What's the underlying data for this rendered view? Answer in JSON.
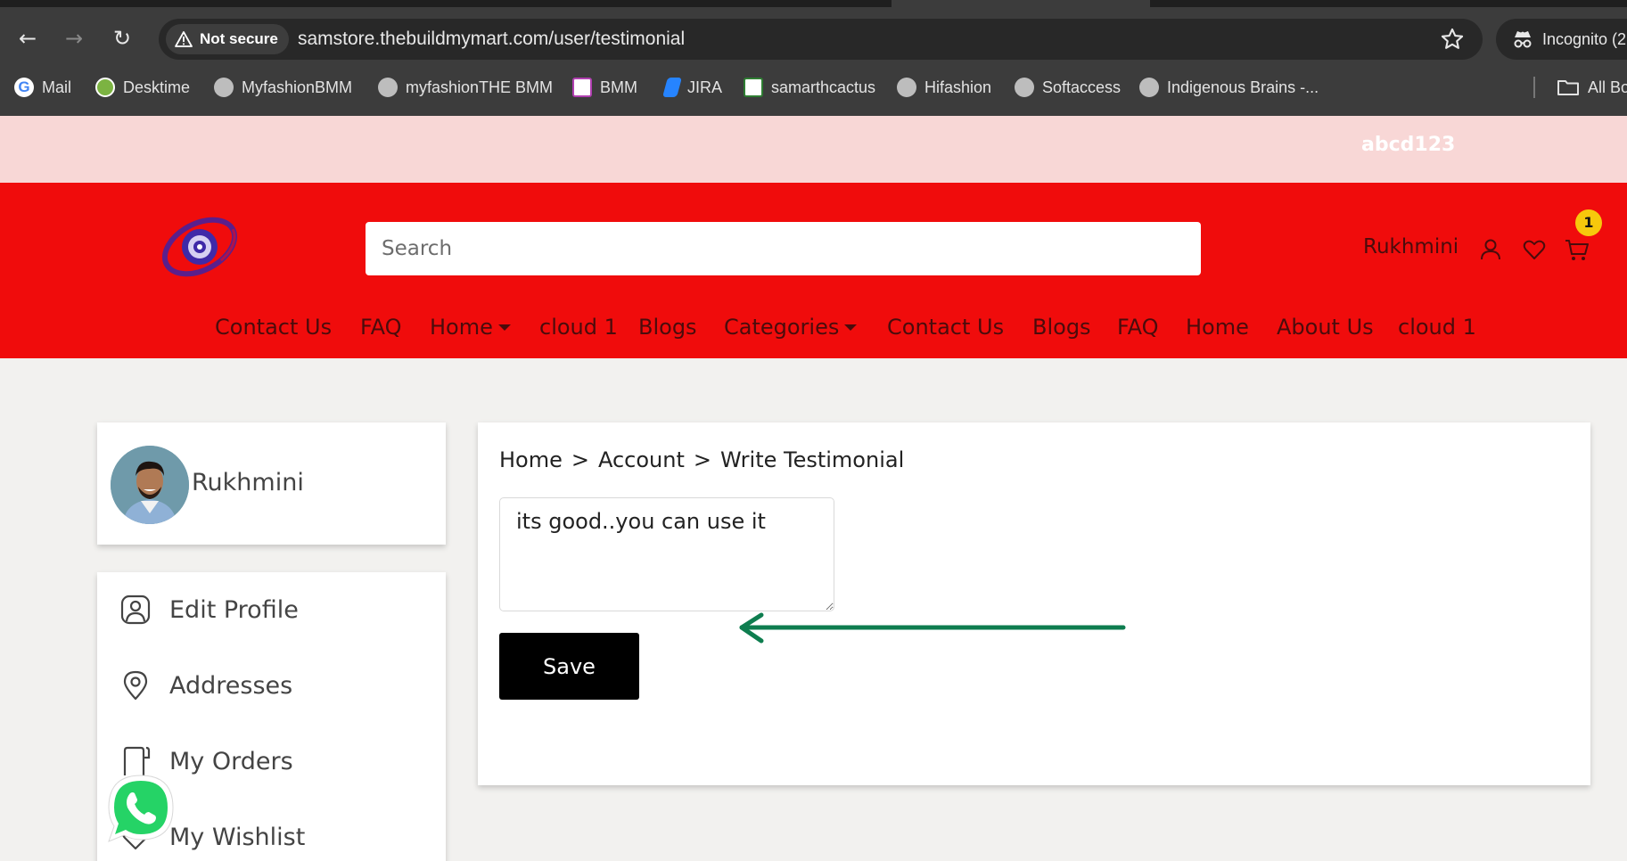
{
  "browser": {
    "security_label": "Not secure",
    "url": "samstore.thebuildmymart.com/user/testimonial",
    "incognito_label": "Incognito (2",
    "bookmarks": [
      {
        "label": "Mail",
        "icon": "google-icon"
      },
      {
        "label": "Desktime",
        "icon": "desktime-icon"
      },
      {
        "label": "MyfashionBMM",
        "icon": "globe-icon"
      },
      {
        "label": "myfashionTHE BMM",
        "icon": "globe-icon"
      },
      {
        "label": "BMM",
        "icon": "bmm-icon"
      },
      {
        "label": "JIRA",
        "icon": "jira-icon"
      },
      {
        "label": "samarthcactus",
        "icon": "cactus-icon"
      },
      {
        "label": "Hifashion",
        "icon": "globe-icon"
      },
      {
        "label": "Softaccess",
        "icon": "globe-icon"
      },
      {
        "label": "Indigenous Brains -...",
        "icon": "globe-icon"
      }
    ],
    "all_bookmarks_label": "All Bo"
  },
  "topbar": {
    "text": "abcd123"
  },
  "header": {
    "search_placeholder": "Search",
    "user_name": "Rukhmini",
    "cart_count": "1",
    "nav": [
      {
        "label": "Contact Us"
      },
      {
        "label": "FAQ"
      },
      {
        "label": "Home",
        "dropdown": true
      },
      {
        "label": "cloud 1"
      },
      {
        "label": "Blogs"
      },
      {
        "label": "Categories",
        "dropdown": true
      },
      {
        "label": "Contact Us"
      },
      {
        "label": "Blogs"
      },
      {
        "label": "FAQ"
      },
      {
        "label": "Home"
      },
      {
        "label": "About Us"
      },
      {
        "label": "cloud 1"
      }
    ]
  },
  "sidebar": {
    "profile_name": "Rukhmini",
    "menu": [
      {
        "label": "Edit Profile",
        "icon": "user-icon"
      },
      {
        "label": "Addresses",
        "icon": "location-pin-icon"
      },
      {
        "label": "My Orders",
        "icon": "orders-icon"
      },
      {
        "label": "My Wishlist",
        "icon": "heart-icon"
      }
    ]
  },
  "main": {
    "breadcrumb": [
      "Home",
      "Account",
      "Write Testimonial"
    ],
    "breadcrumb_separator": ">",
    "testimonial_value": "its good..you can use it",
    "save_label": "Save"
  },
  "colors": {
    "header_red": "#f00c0c",
    "topbar_pink": "#f8d7d6",
    "badge_yellow": "#f7c80c",
    "annotation_green": "#0e7d4f",
    "whatsapp_green": "#25d366"
  }
}
